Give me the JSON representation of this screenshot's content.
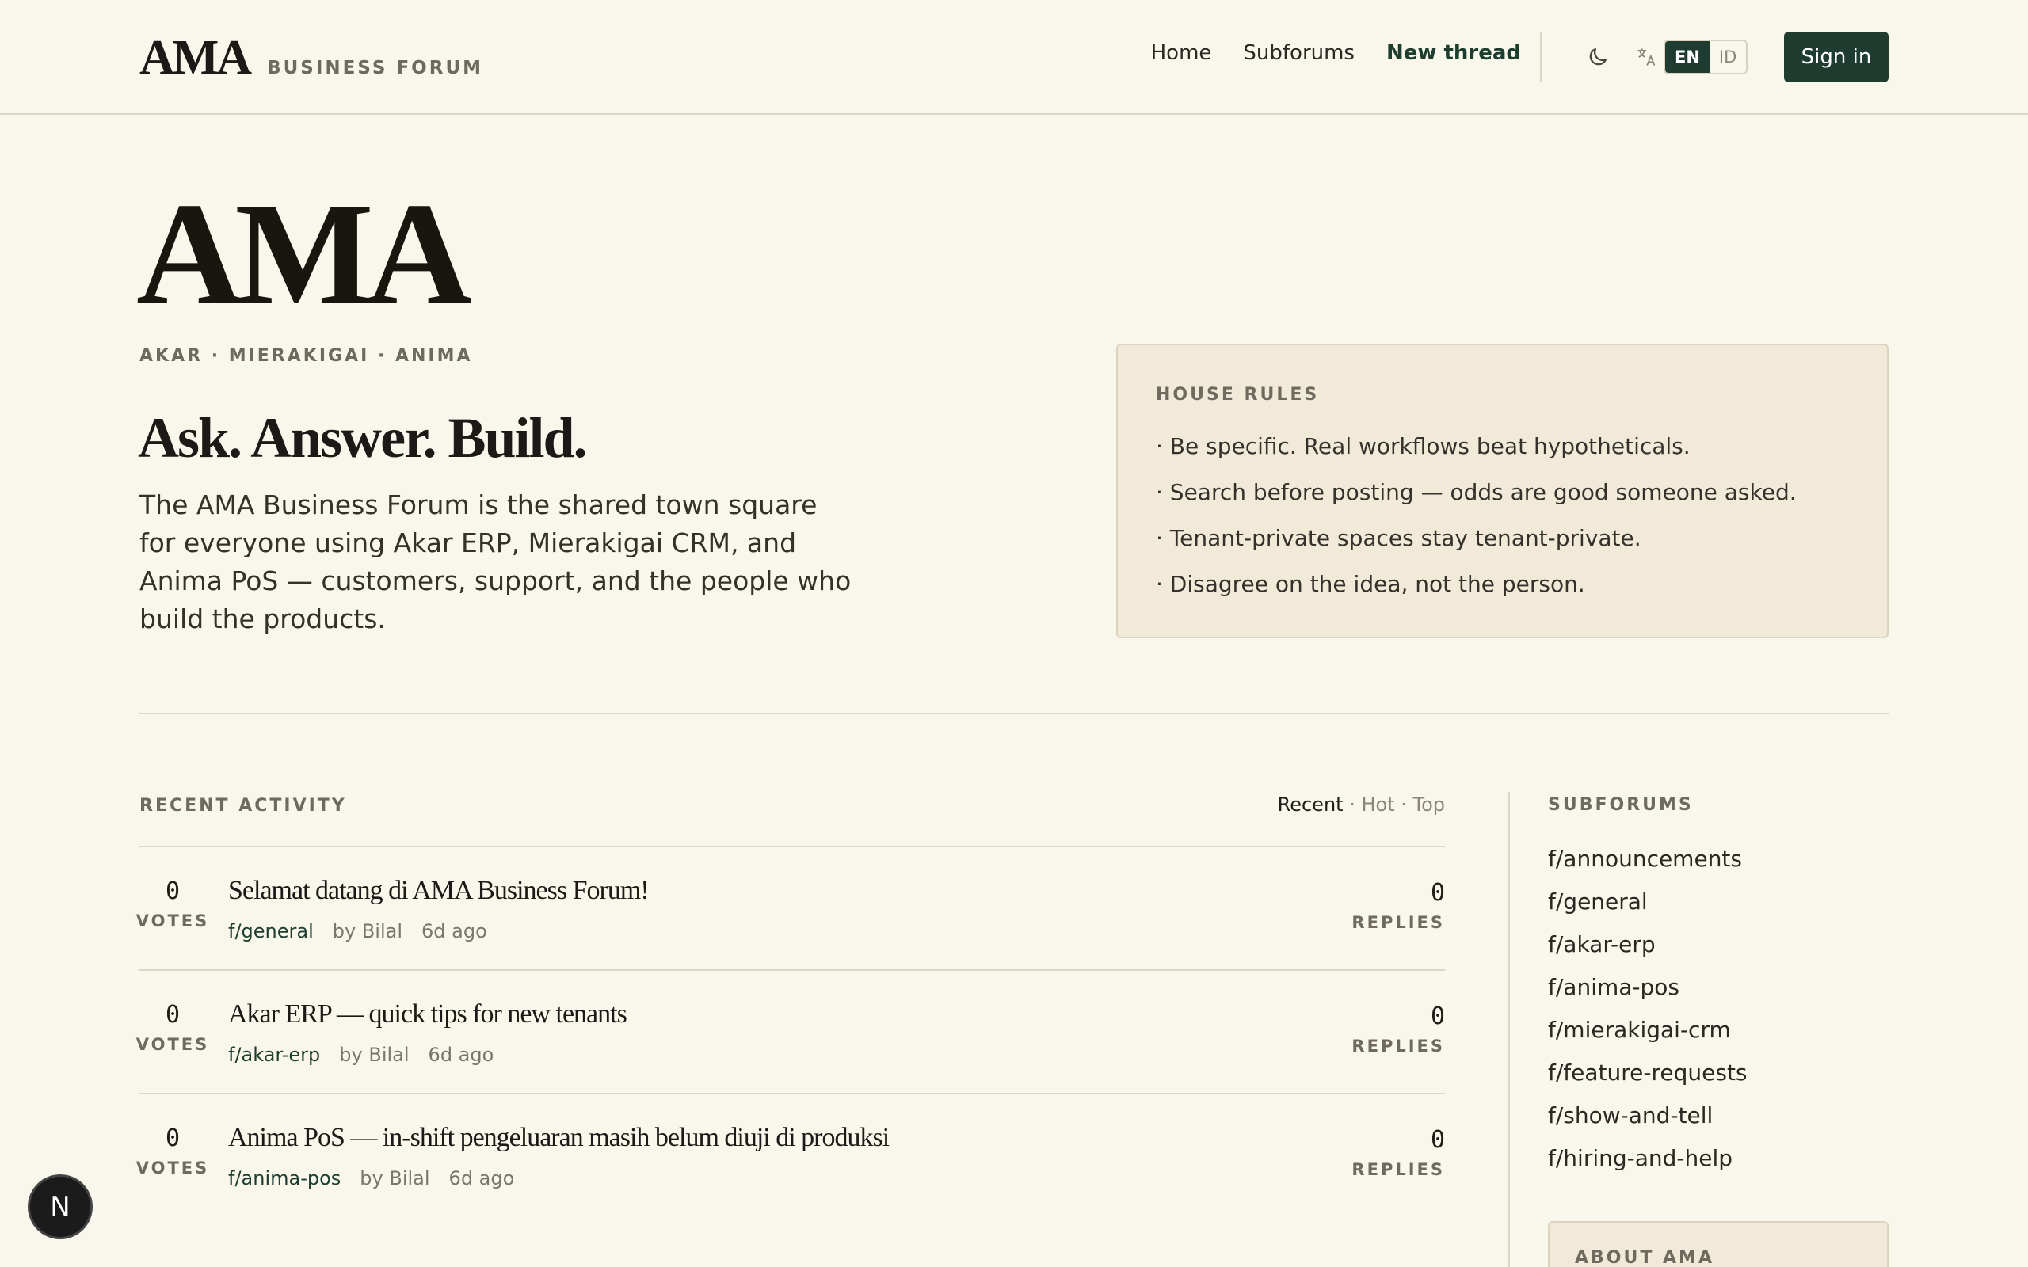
{
  "header": {
    "logo": "AMA",
    "subtitle": "BUSINESS FORUM",
    "nav": [
      {
        "label": "Home"
      },
      {
        "label": "Subforums"
      },
      {
        "label": "New thread"
      }
    ],
    "lang_active": "EN",
    "lang_other": "ID",
    "signin_label": "Sign in"
  },
  "hero": {
    "title": "AMA",
    "tagline": "AKAR · MIERAKIGAI · ANIMA",
    "heading": "Ask. Answer. Build.",
    "description": "The AMA Business Forum is the shared town square for everyone using Akar ERP, Mierakigai CRM, and Anima PoS — customers, support, and the people who build the products."
  },
  "rules": {
    "title": "HOUSE RULES",
    "items": [
      "· Be specific. Real workflows beat hypotheticals.",
      "· Search before posting — odds are good someone asked.",
      "· Tenant-private spaces stay tenant-private.",
      "· Disagree on the idea, not the person."
    ]
  },
  "recent": {
    "title": "RECENT ACTIVITY",
    "sort": {
      "recent": "Recent",
      "sep": " · ",
      "hot": "Hot",
      "top": "Top"
    },
    "votes_label": "VOTES",
    "replies_label": "REPLIES",
    "threads": [
      {
        "votes": "0",
        "title": "Selamat datang di AMA Business Forum!",
        "subforum": "f/general",
        "author": "by Bilal",
        "time": "6d ago",
        "replies": "0"
      },
      {
        "votes": "0",
        "title": "Akar ERP — quick tips for new tenants",
        "subforum": "f/akar-erp",
        "author": "by Bilal",
        "time": "6d ago",
        "replies": "0"
      },
      {
        "votes": "0",
        "title": "Anima PoS — in-shift pengeluaran masih belum diuji di produksi",
        "subforum": "f/anima-pos",
        "author": "by Bilal",
        "time": "6d ago",
        "replies": "0"
      }
    ]
  },
  "sidebar": {
    "title": "SUBFORUMS",
    "items": [
      "f/announcements",
      "f/general",
      "f/akar-erp",
      "f/anima-pos",
      "f/mierakigai-crm",
      "f/feature-requests",
      "f/show-and-tell",
      "f/hiring-and-help"
    ],
    "about_title": "ABOUT AMA"
  },
  "badge": "N",
  "icons": {
    "theme": "moon-icon",
    "translate": "translate-icon"
  }
}
